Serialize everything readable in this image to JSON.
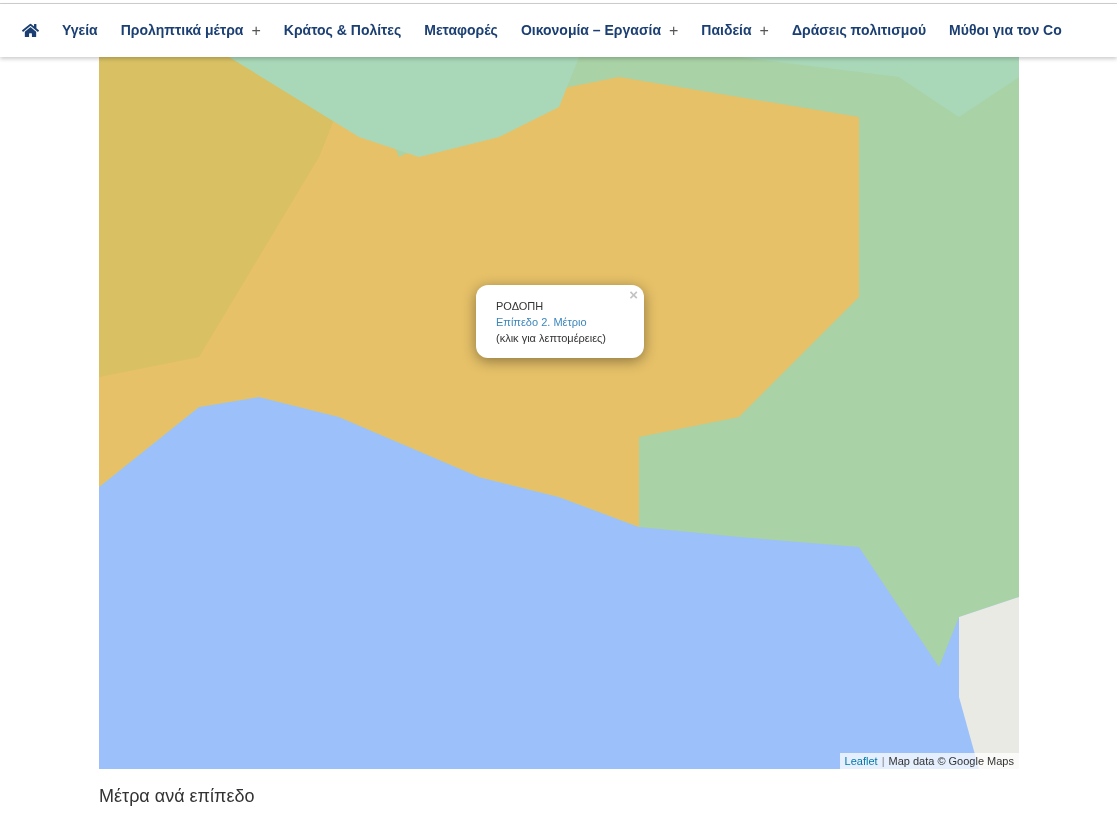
{
  "nav": {
    "items": [
      {
        "label": "Υγεία",
        "has_submenu": false
      },
      {
        "label": "Προληπτικά μέτρα",
        "has_submenu": true,
        "submenu_marker": "+"
      },
      {
        "label": "Κράτος & Πολίτες",
        "has_submenu": false
      },
      {
        "label": "Μεταφορές",
        "has_submenu": false
      },
      {
        "label": "Οικονομία – Εργασία",
        "has_submenu": true,
        "submenu_marker": "+"
      },
      {
        "label": "Παιδεία",
        "has_submenu": true,
        "submenu_marker": "+"
      },
      {
        "label": "Δράσεις πολιτισμού",
        "has_submenu": false
      },
      {
        "label": "Μύθοι για τον Co",
        "has_submenu": false
      }
    ]
  },
  "map": {
    "popup": {
      "title": "ΡΟΔΟΠΗ",
      "link": "Επίπεδο 2. Μέτριο",
      "note": "(κλικ για λεπτομέρειες)",
      "close": "×"
    },
    "attribution": {
      "link": "Leaflet",
      "separator": "|",
      "text": "Map data © Google Maps"
    }
  },
  "heading": "Μέτρα ανά επίπεδο"
}
